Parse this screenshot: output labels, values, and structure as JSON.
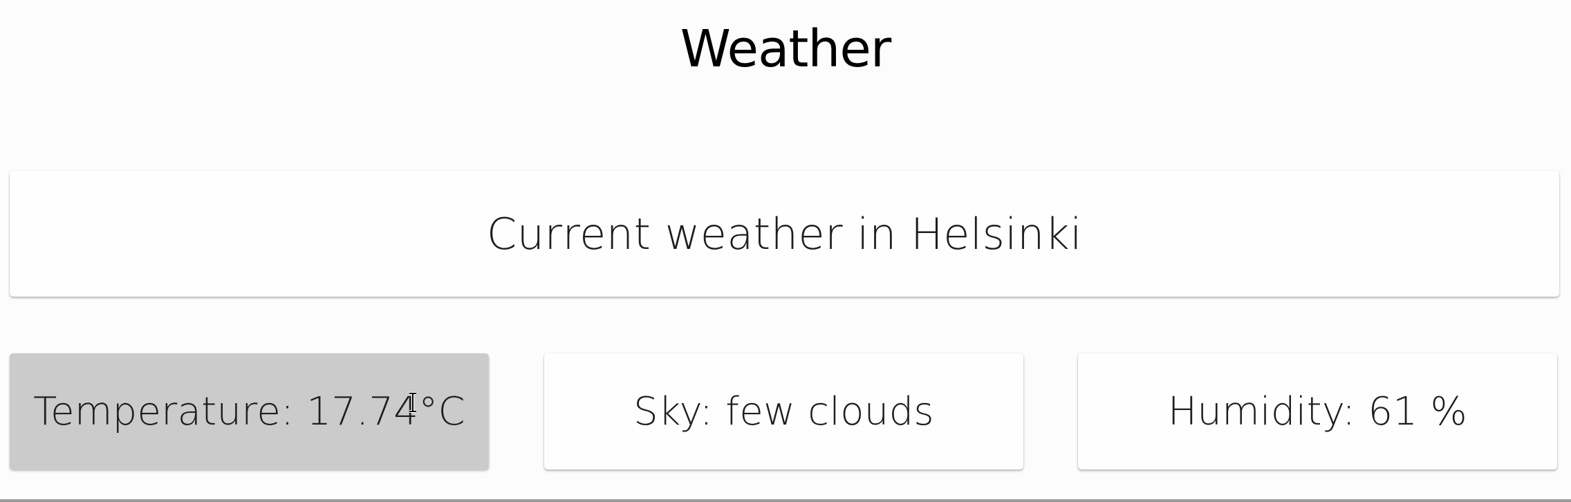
{
  "page": {
    "title": "Weather"
  },
  "current": {
    "heading": "Current weather in Helsinki"
  },
  "stats": {
    "temperature": "Temperature: 17.74°C",
    "sky": "Sky: few clouds",
    "humidity": "Humidity: 61 %"
  },
  "cursor": {
    "icon": "text-cursor-icon"
  },
  "colors": {
    "background": "#fcfcfc",
    "card": "#fefefe",
    "hovered_card": "#cbcbcb",
    "text": "#1e1e1e"
  }
}
